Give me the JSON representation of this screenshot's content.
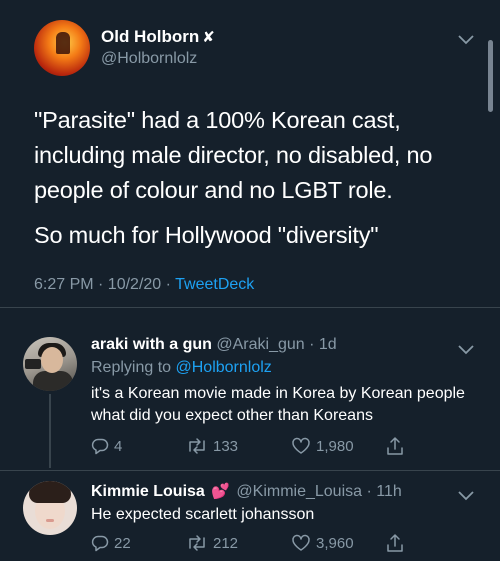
{
  "main_tweet": {
    "author_name": "Old Holborn",
    "author_badge": "✘",
    "author_handle": "@Holbornlolz",
    "text_line1": "\"Parasite\" had a 100% Korean cast, including male director, no disabled, no people of colour and no LGBT role.",
    "text_line2": "So much for Hollywood \"diversity\"",
    "time": "6:27 PM · 10/2/20 · ",
    "source": "TweetDeck"
  },
  "replies": [
    {
      "author_name": "araki with a gun",
      "author_handle": "@Araki_gun · 1d",
      "replying_prefix": "Replying to ",
      "replying_to": "@Holbornlolz",
      "text": "it's a Korean movie made in Korea by Korean people what did you expect other than Koreans",
      "reply_count": "4",
      "retweet_count": "133",
      "like_count": "1,980"
    },
    {
      "author_name": "Kimmie Louisa",
      "author_emoji": "💕",
      "author_handle": "@Kimmie_Louisa · 11h",
      "text": "He expected scarlett johansson",
      "reply_count": "22",
      "retweet_count": "212",
      "like_count": "3,960"
    }
  ],
  "icons": [
    "chevron-down-icon",
    "reply-icon",
    "retweet-icon",
    "like-icon",
    "share-icon"
  ],
  "colors": {
    "background": "#15202b",
    "secondary_text": "#8899a6",
    "link": "#1da1f2",
    "divider": "#38444d"
  }
}
